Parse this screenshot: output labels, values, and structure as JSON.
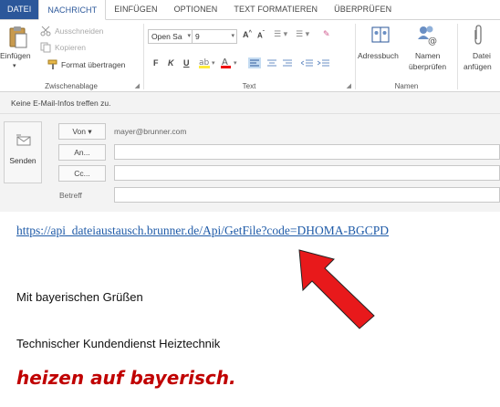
{
  "tabs": [
    "DATEI",
    "NACHRICHT",
    "EINFÜGEN",
    "OPTIONEN",
    "TEXT FORMATIEREN",
    "ÜBERPRÜFEN"
  ],
  "ribbon": {
    "clipboard": {
      "paste": "Einfügen",
      "cut": "Ausschneiden",
      "copy": "Kopieren",
      "format_painter": "Format übertragen",
      "group_label": "Zwischenablage"
    },
    "text": {
      "font_name": "Open Sa",
      "font_size": "9",
      "group_label": "Text"
    },
    "names": {
      "address_book": "Adressbuch",
      "check_names_line1": "Namen",
      "check_names_line2": "überprüfen",
      "group_label": "Namen"
    },
    "attach": {
      "line1": "Datei",
      "line2": "anfügen"
    }
  },
  "header": {
    "info": "Keine E-Mail-Infos treffen zu.",
    "send": "Senden",
    "from_button": "Von ▾",
    "from_value": "mayer@brunner.com",
    "to_button": "An...",
    "cc_button": "Cc...",
    "subject_label": "Betreff"
  },
  "message": {
    "link": "https://api_dateiaustausch.brunner.de/Api/GetFile?code=DHOMA-BGCPD",
    "greeting": "Mit bayerischen Grüßen",
    "department": "Technischer Kundendienst Heiztechnik",
    "slogan": "heizen auf bayerisch."
  },
  "colors": {
    "accent": "#2b579a",
    "link": "#1f5ba8",
    "slogan": "#c00000",
    "arrow": "#e8191b"
  }
}
